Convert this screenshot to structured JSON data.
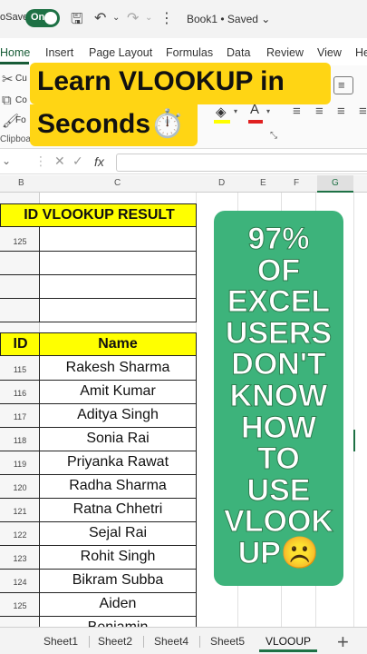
{
  "titlebar": {
    "autosave_label": "oSave",
    "toggle_label": "On",
    "doc_title": "Book1 • Saved ⌄"
  },
  "ribbon_tabs": [
    "Home",
    "Insert",
    "Page Layout",
    "Formulas",
    "Data",
    "Review",
    "View",
    "He"
  ],
  "ribbon": {
    "cut_label": "Cu",
    "copy_label": "Co",
    "format_label": "Fo",
    "clipboard_label": "Clipboa"
  },
  "banner": {
    "line1": "Learn VLOOKUP in",
    "line2": "Seconds⏱️"
  },
  "formula_bar": {
    "fx": "fx"
  },
  "columns": [
    "B",
    "C",
    "D",
    "E",
    "F",
    "G"
  ],
  "lookup_table": {
    "header": "ID VLOOKUP RESULT",
    "rows": [
      {
        "id": "125",
        "result": ""
      },
      {
        "id": "",
        "result": ""
      },
      {
        "id": "",
        "result": ""
      },
      {
        "id": "",
        "result": ""
      }
    ]
  },
  "data_table": {
    "headers": [
      "ID",
      "Name"
    ],
    "rows": [
      {
        "id": "115",
        "name": "Rakesh Sharma"
      },
      {
        "id": "116",
        "name": "Amit Kumar"
      },
      {
        "id": "117",
        "name": "Aditya Singh"
      },
      {
        "id": "118",
        "name": "Sonia Rai"
      },
      {
        "id": "119",
        "name": "Priyanka Rawat"
      },
      {
        "id": "120",
        "name": "Radha Sharma"
      },
      {
        "id": "121",
        "name": "Ratna Chhetri"
      },
      {
        "id": "122",
        "name": "Sejal Rai"
      },
      {
        "id": "123",
        "name": "Rohit  Singh"
      },
      {
        "id": "124",
        "name": "Bikram Subba"
      },
      {
        "id": "125",
        "name": "Aiden"
      },
      {
        "id": "",
        "name": "Benjamin"
      }
    ]
  },
  "overlay": {
    "lines": [
      "97%",
      "OF",
      "EXCEL",
      "USERS",
      "DON'T",
      "KNOW",
      "HOW",
      "TO",
      "USE",
      "VLOOK",
      "UP☹️"
    ]
  },
  "sheets": {
    "tabs": [
      "Sheet1",
      "Sheet2",
      "Sheet4",
      "Sheet5",
      "VLOOUP"
    ],
    "active": "VLOOUP",
    "add_label": "+"
  },
  "colors": {
    "excel_green": "#1e7145",
    "highlight_yellow": "#ffff00",
    "overlay_green": "#3db37b",
    "banner_yellow": "#ffd514"
  }
}
